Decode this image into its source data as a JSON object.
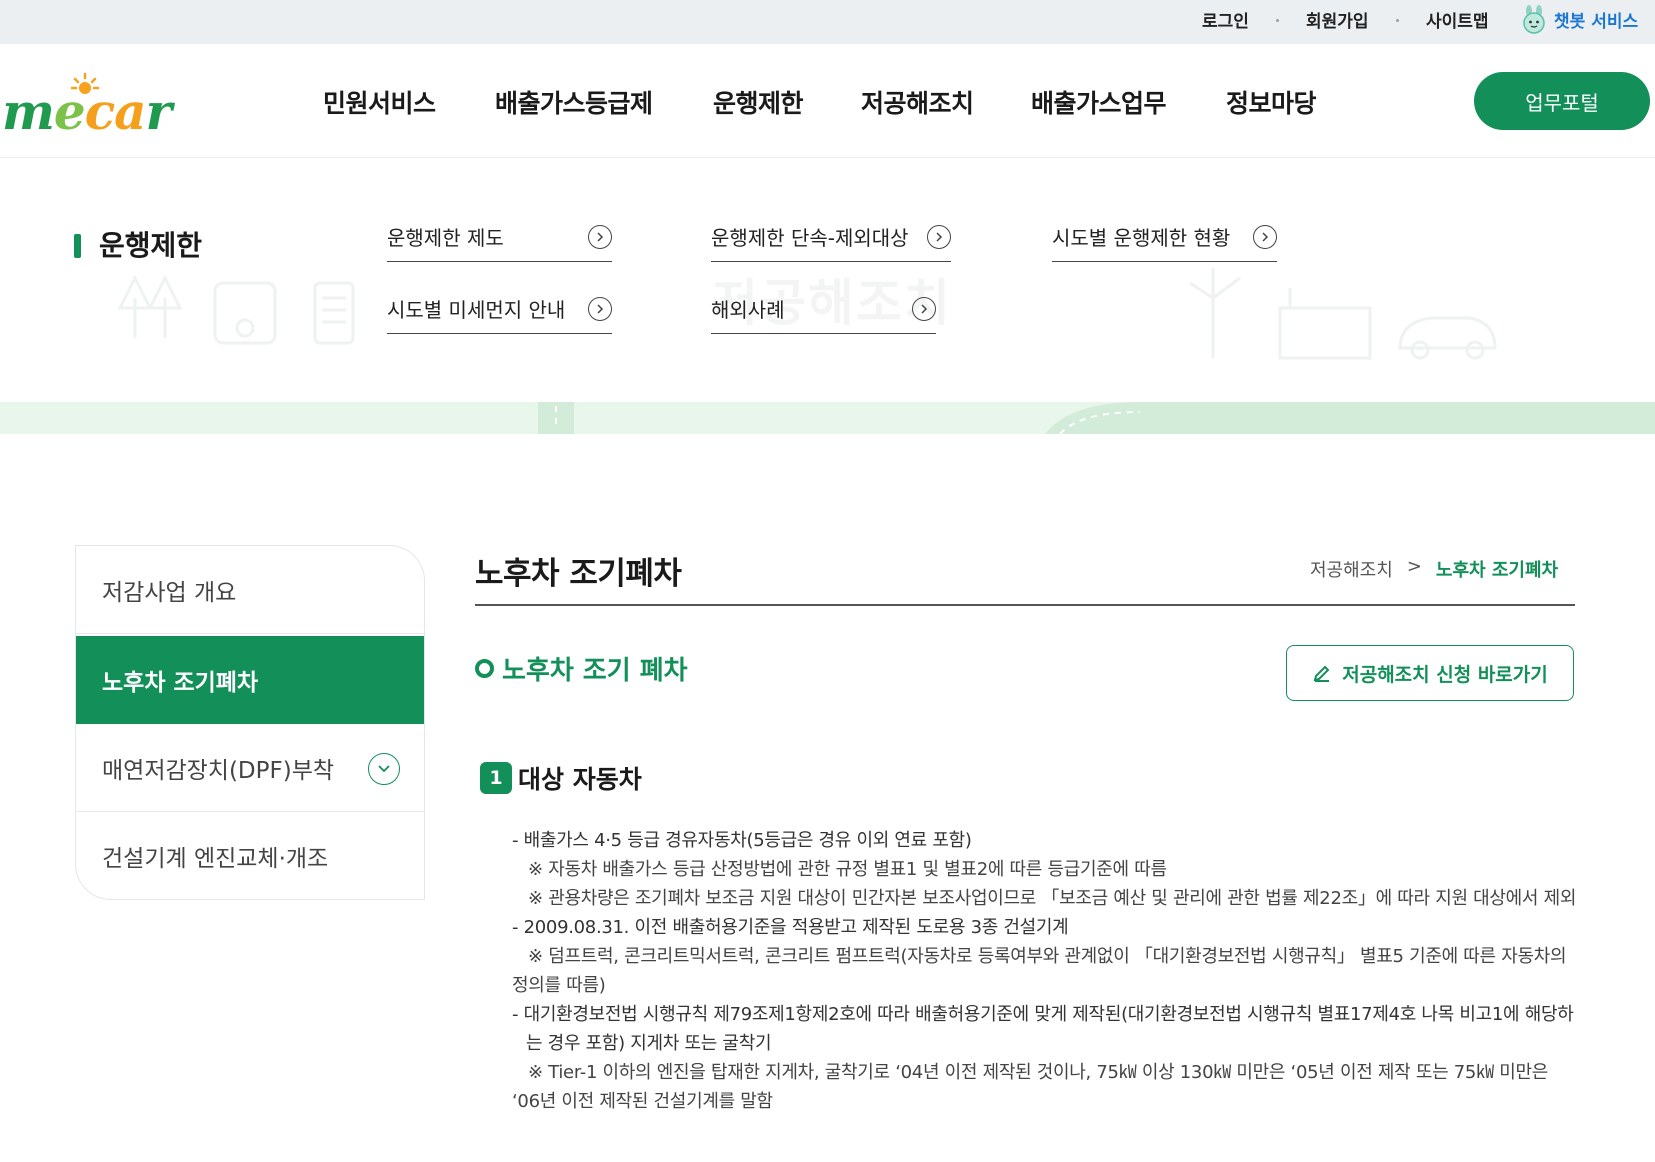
{
  "util": {
    "login": "로그인",
    "signup": "회원가입",
    "sitemap": "사이트맵",
    "chatbot": "챗봇 서비스"
  },
  "logo": {
    "text": "mecar"
  },
  "nav": {
    "items": [
      "민원서비스",
      "배출가스등급제",
      "운행제한",
      "저공해조치",
      "배출가스업무",
      "정보마당"
    ],
    "portal": "업무포털"
  },
  "mega": {
    "title": "운행제한",
    "watermark": "저공해조치",
    "links": [
      "운행제한 제도",
      "운행제한 단속-제외대상",
      "시도별 운행제한 현황",
      "시도별 미세먼지 안내",
      "해외사례"
    ]
  },
  "side": {
    "items": [
      "저감사업 개요",
      "노후차 조기폐차",
      "매연저감장치(DPF)부착",
      "건설기계 엔진교체·개조"
    ]
  },
  "content": {
    "page_title": "노후차 조기폐차",
    "breadcrumb": {
      "parent": "저공해조치",
      "separator": ">",
      "current": "노후차 조기폐차"
    },
    "section_title": "노후차 조기 폐차",
    "apply_button": "저공해조치 신청 바로가기",
    "sub_number": "1",
    "sub_title": "대상 자동차",
    "lines": {
      "l1": "- 배출가스 4·5 등급 경유자동차(5등급은 경유 이외 연료 포함)",
      "l2": "※ 자동차 배출가스 등급 산정방법에 관한 규정 별표1 및 별표2에 따른 등급기준에 따름",
      "l3": "※ 관용차량은 조기폐차 보조금 지원 대상이 민간자본 보조사업이므로 「보조금 예산 및 관리에 관한 법률 제22조」에 따라 지원 대상에서 제외",
      "l4": "- 2009.08.31. 이전 배출허용기준을 적용받고 제작된 도로용 3종 건설기계",
      "l5": "※ 덤프트럭, 콘크리트믹서트럭, 콘크리트 펌프트럭(자동차로 등록여부와 관계없이 「대기환경보전법 시행규칙」 별표5 기준에 따른 자동차의 정의를 따름)",
      "l6": "- 대기환경보전법 시행규칙 제79조제1항제2호에 따라 배출허용기준에 맞게 제작된(대기환경보전법 시행규칙 별표17제4호 나목 비고1에 해당하는 경우 포함) 지게차 또는 굴착기",
      "l7": "※ Tier-1 이하의 엔진을 탑재한 지게차, 굴착기로 ‘04년 이전 제작된 것이나, 75㎾ 이상 130㎾ 미만은 ‘05년 이전 제작 또는 75㎾ 미만은 ‘06년 이전 제작된 건설기계를 말함"
    }
  },
  "colors": {
    "brand_green": "#138f5a",
    "chatbot_blue": "#1b77d0",
    "util_bg": "#eceff2"
  }
}
